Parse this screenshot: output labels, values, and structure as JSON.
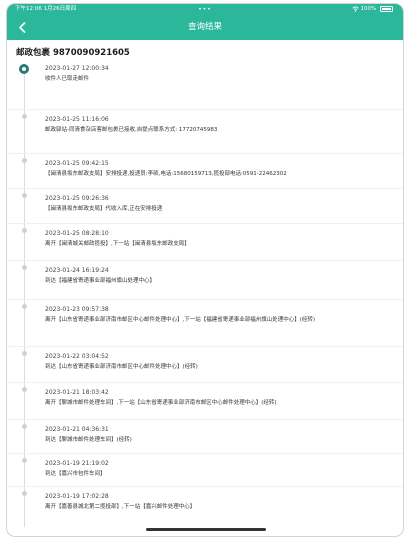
{
  "status_bar": {
    "time": "下午12:06",
    "date": "1月26日周四",
    "dots": "•••",
    "battery": "100%"
  },
  "nav": {
    "title": "查询结果",
    "back_icon": "chevron-left-icon"
  },
  "parcel": {
    "label": "邮政包裹 9870090921605"
  },
  "colors": {
    "header": "#2bb79a",
    "active_dot": "#2c7a75"
  },
  "events": [
    {
      "time": "2023-01-27 12:00:34",
      "desc": "收件人已取走邮件"
    },
    {
      "time": "2023-01-25 11:16:06",
      "desc": "邮政驿站-同清食杂店客邮包裹已接收,自提点联系方式: 17720745983"
    },
    {
      "time": "2023-01-25 09:42:15",
      "desc": "【闽清县坂东邮政支局】安排投递,投递员:李硕,电话:15680159713,揽投部电话:0591-22462302"
    },
    {
      "time": "2023-01-25 09:26:36",
      "desc": "【闽清县坂东邮政支局】代收入库,正在安排投递"
    },
    {
      "time": "2023-01-25 08:28:10",
      "desc": "离开【闽清城关邮政揽投】,下一站【闽清县坂东邮政支局】"
    },
    {
      "time": "2023-01-24 16:19:24",
      "desc": "到达【福建省寄递事业部福州旗山处理中心】"
    },
    {
      "time": "2023-01-23 09:57:38",
      "desc": "离开【山东省寄递事业部济南市邮区中心邮件处理中心】,下一站【福建省寄递事业部福州旗山处理中心】(经转)"
    },
    {
      "time": "2023-01-22 03:04:52",
      "desc": "到达【山东省寄递事业部济南市邮区中心邮件处理中心】(经转)"
    },
    {
      "time": "2023-01-21 18:03:42",
      "desc": "离开【聊城市邮件处理车间】,下一站【山东省寄递事业部济南市邮区中心邮件处理中心】(经转)"
    },
    {
      "time": "2023-01-21 04:36:31",
      "desc": "到达【聊城市邮件处理车间】(经转)"
    },
    {
      "time": "2023-01-19 21:19:02",
      "desc": "到达【嘉兴市包件车间】"
    },
    {
      "time": "2023-01-19 17:02:28",
      "desc": "离开【嘉善县城北第二揽投部】,下一站【嘉兴邮件处理中心】"
    }
  ]
}
